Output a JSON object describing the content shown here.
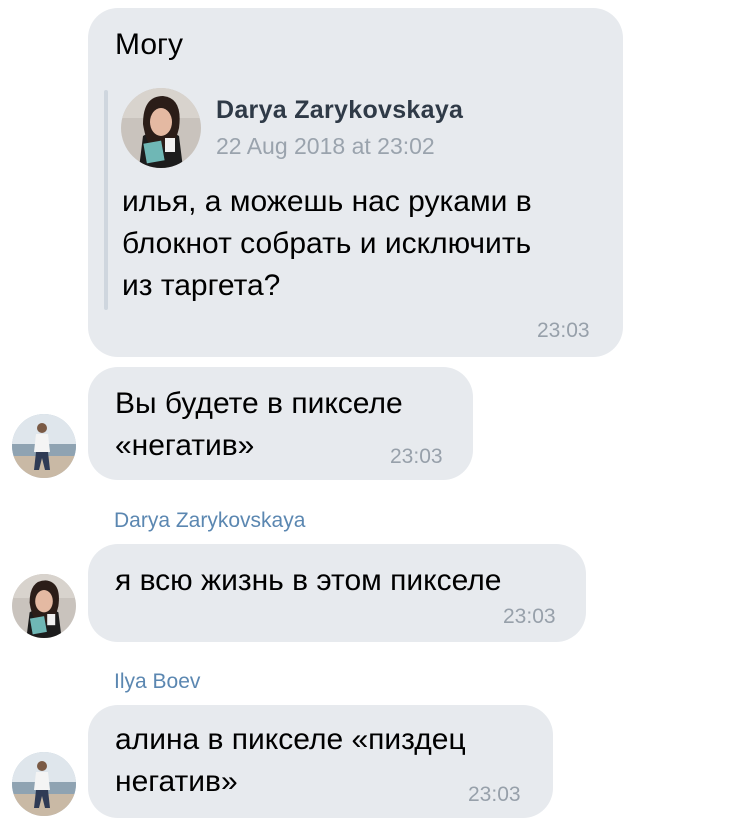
{
  "messages": [
    {
      "text": "Могу",
      "time": "23:03",
      "quote": {
        "author": "Darya Zarykovskaya",
        "date": "22 Aug 2018 at 23:02",
        "text": "илья, а можешь нас руками в\nблокнот собрать и исключить\nиз таргета?",
        "avatar_icon": "woman-portrait-avatar"
      }
    },
    {
      "text": "Вы будете в пикселе\n«негатив»",
      "time": "23:03",
      "avatar_icon": "man-beach-avatar"
    },
    {
      "sender": "Darya Zarykovskaya",
      "text": "я всю жизнь в этом пикселе",
      "time": "23:03",
      "avatar_icon": "woman-portrait-avatar"
    },
    {
      "sender": "Ilya Boev",
      "text": "алина в пикселе «пиздец\nнегатив»",
      "time": "23:03",
      "avatar_icon": "man-beach-avatar"
    }
  ],
  "colors": {
    "bubble": "#e7eaee",
    "sender_name": "#5b87b1",
    "timestamp": "#97a0aa"
  }
}
